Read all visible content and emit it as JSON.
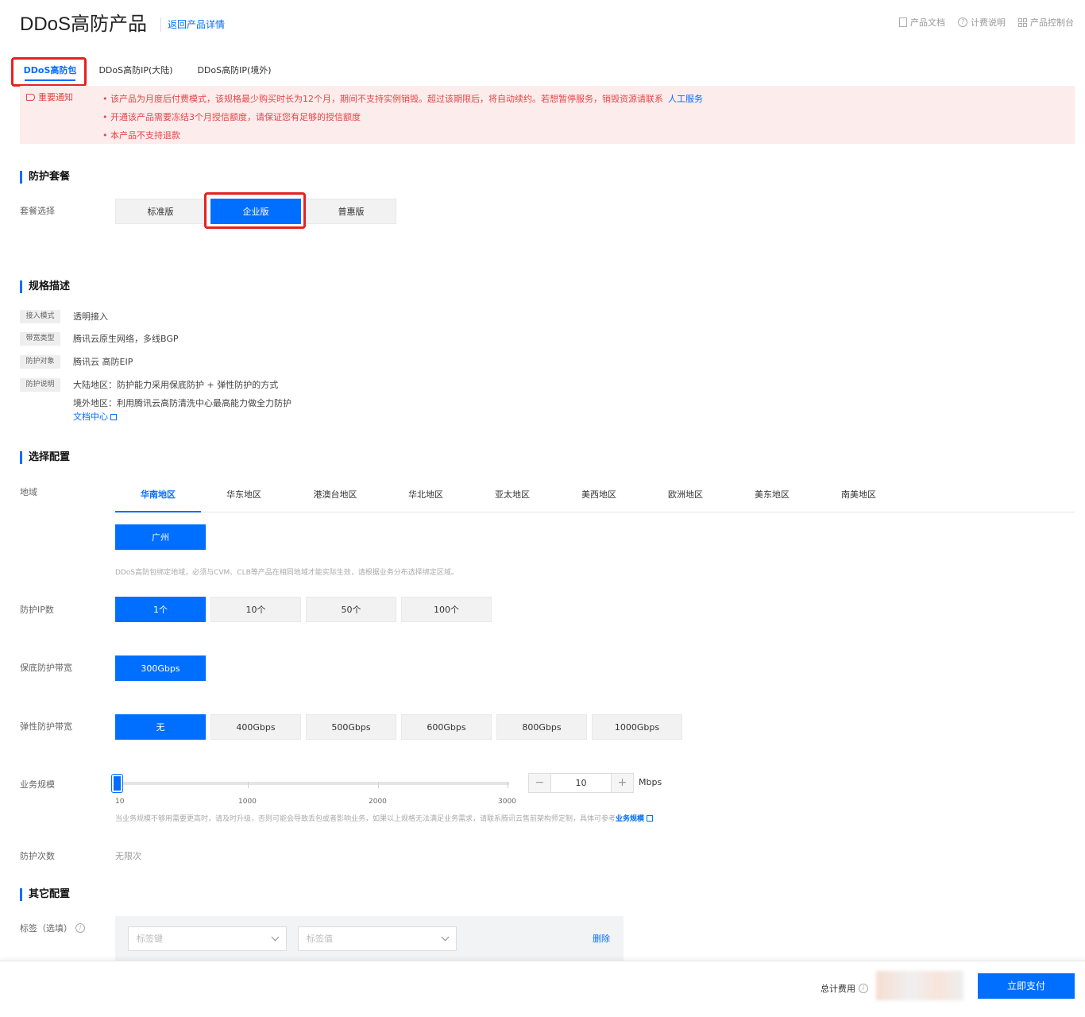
{
  "header": {
    "title": "DDoS高防产品",
    "back_link": "返回产品详情",
    "links": [
      "产品文档",
      "计费说明",
      "产品控制台"
    ]
  },
  "tabs": [
    "DDoS高防包",
    "DDoS高防IP(大陆)",
    "DDoS高防IP(境外)"
  ],
  "notice": {
    "label": "重要通知",
    "items": [
      "该产品为月度后付费模式，该规格最少购买时长为12个月，期间不支持实例销毁。超过该期限后，将自动续约。若想暂停服务，销毁资源请联系",
      "开通该产品需要冻结3个月授信额度，请保证您有足够的授信额度",
      "本产品不支持退款"
    ],
    "link": "人工服务"
  },
  "package": {
    "section_title": "防护套餐",
    "label": "套餐选择",
    "options": [
      "标准版",
      "企业版",
      "普惠版"
    ],
    "selected": "企业版"
  },
  "spec": {
    "section_title": "规格描述",
    "rows": [
      {
        "key": "接入模式",
        "value": "透明接入"
      },
      {
        "key": "带宽类型",
        "value": "腾讯云原生网络，多线BGP"
      },
      {
        "key": "防护对象",
        "value": "腾讯云 高防EIP"
      },
      {
        "key": "防护说明",
        "value": "大陆地区：防护能力采用保底防护 + 弹性防护的方式"
      }
    ],
    "extra_line": "境外地区：利用腾讯云高防清洗中心最高能力做全力防护",
    "doc_link": "文档中心"
  },
  "config": {
    "section_title": "选择配置",
    "region_label": "地域",
    "regions": [
      "华南地区",
      "华东地区",
      "港澳台地区",
      "华北地区",
      "亚太地区",
      "美西地区",
      "欧洲地区",
      "美东地区",
      "南美地区"
    ],
    "active_region": "华南地区",
    "city": "广州",
    "region_hint": "DDoS高防包绑定地域，必须与CVM、CLB等产品在相同地域才能实际生效，请根据业务分布选择绑定区域。",
    "ip_label": "防护IP数",
    "ip_options": [
      "1个",
      "10个",
      "50个",
      "100个"
    ],
    "ip_selected": "1个",
    "base_label": "保底防护带宽",
    "base_options": [
      "300Gbps"
    ],
    "elastic_label": "弹性防护带宽",
    "elastic_options": [
      "无",
      "400Gbps",
      "500Gbps",
      "600Gbps",
      "800Gbps",
      "1000Gbps"
    ],
    "elastic_selected": "无",
    "scale_label": "业务规模",
    "scale_ticks": [
      "10",
      "1000",
      "2000",
      "3000"
    ],
    "scale_value": "10",
    "scale_unit": "Mbps",
    "scale_hint": "当业务规模不够用需要更高时，请及时升级，否则可能会导致丢包或者影响业务，如果以上规格无法满足业务需求，请联系腾讯云售前架构师定制，具体可参考",
    "scale_link": "业务规模",
    "times_label": "防护次数",
    "times_value": "无限次"
  },
  "other": {
    "section_title": "其它配置",
    "tag_label": "标签（选填）",
    "tag_key_placeholder": "标签键",
    "tag_value_placeholder": "标签值",
    "delete": "删除"
  },
  "footer": {
    "total_label": "总计费用",
    "pay_button": "立即支付"
  },
  "colors": {
    "accent": "#006eff",
    "warning": "#e54545",
    "highlight_box": "#e52121"
  }
}
